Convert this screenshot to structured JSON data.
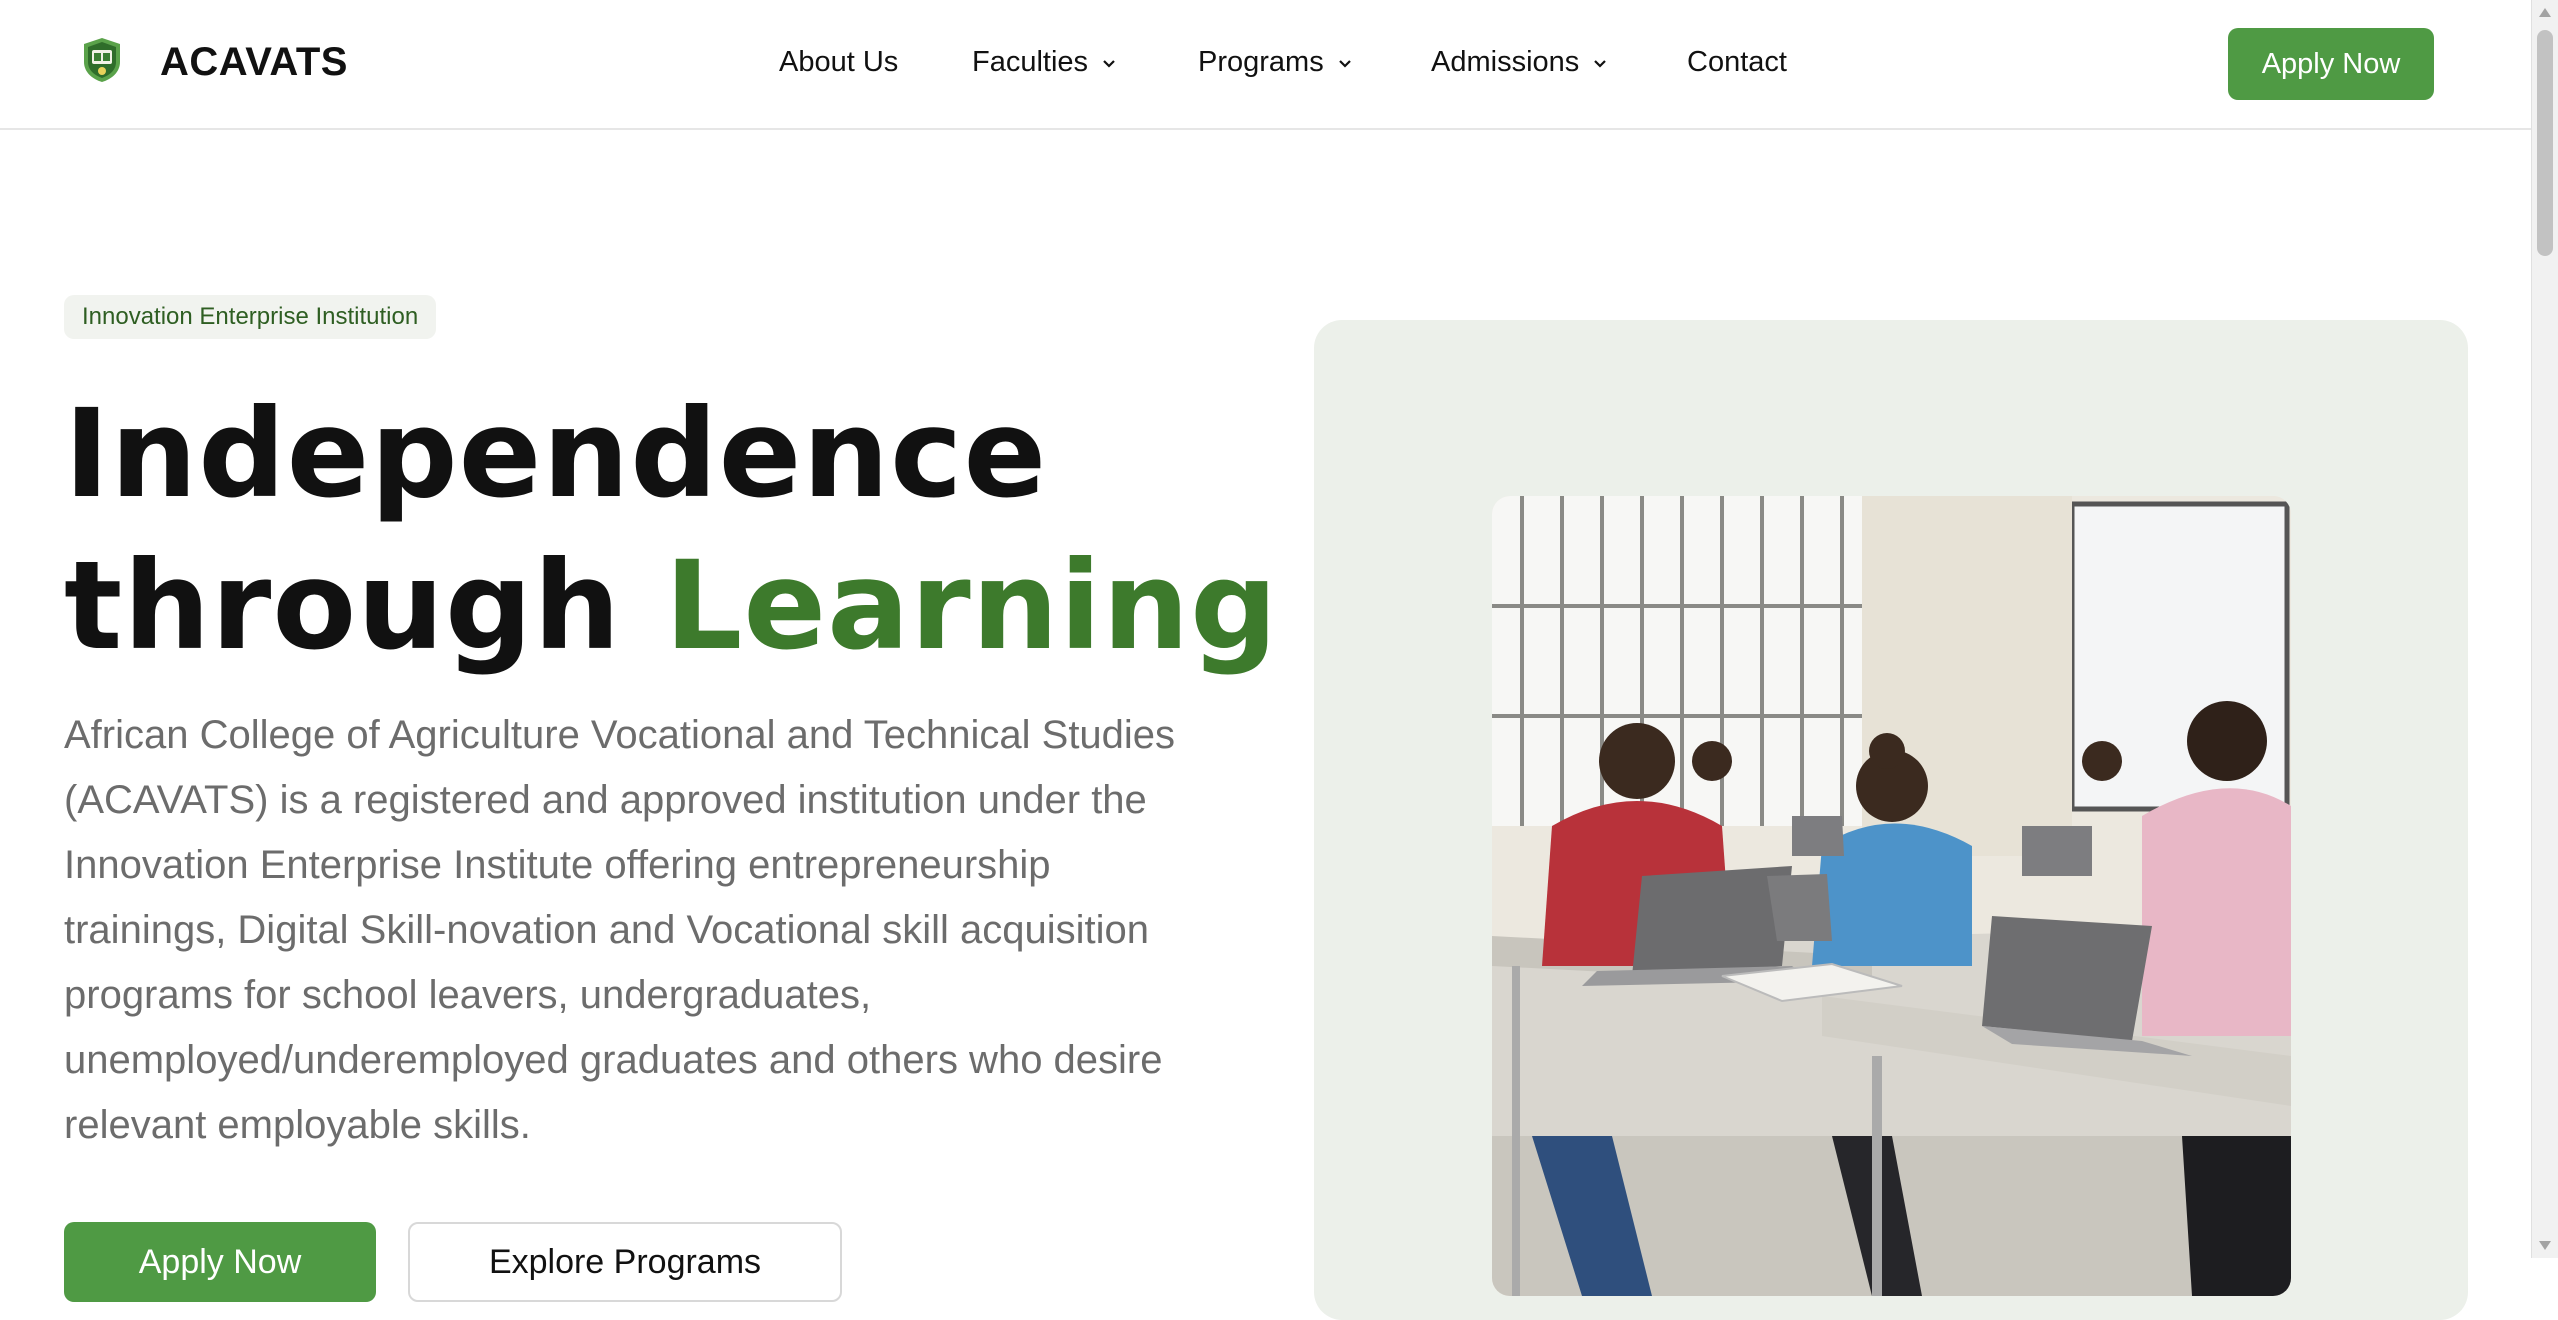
{
  "header": {
    "brand": "ACAVATS",
    "nav": [
      {
        "label": "About Us",
        "dropdown": false
      },
      {
        "label": "Faculties",
        "dropdown": true
      },
      {
        "label": "Programs",
        "dropdown": true
      },
      {
        "label": "Admissions",
        "dropdown": true
      },
      {
        "label": "Contact",
        "dropdown": false
      }
    ],
    "apply_label": "Apply Now"
  },
  "hero": {
    "badge": "Innovation Enterprise Institution",
    "headline_line1": "Independence",
    "headline_line2_plain": "through ",
    "headline_line2_accent": "Learning",
    "description": "African College of Agriculture Vocational and Technical Studies (ACAVATS) is a registered and approved institution under the Innovation Enterprise Institute offering entrepreneurship trainings, Digital Skill-novation and Vocational skill acquisition programs for school leavers, undergraduates, unemployed/underemployed graduates and others who desire relevant employable skills.",
    "primary_button": "Apply Now",
    "secondary_button": "Explore Programs"
  },
  "colors": {
    "brand_green": "#4f9a44",
    "accent_text_green": "#3d7a2c",
    "badge_bg": "#f1f3ef",
    "panel_bg": "#ecf0ea"
  },
  "icons": {
    "logo": "acavats-crest-icon",
    "dropdown": "chevron-down-icon"
  }
}
